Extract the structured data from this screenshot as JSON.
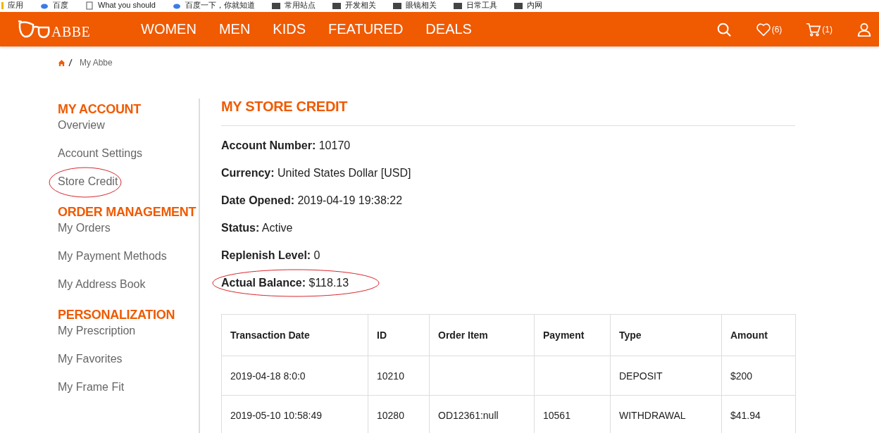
{
  "bookmarks": [
    {
      "label": "应用",
      "kind": "apps"
    },
    {
      "label": "百度",
      "kind": "cloud"
    },
    {
      "label": "What you should",
      "kind": "page"
    },
    {
      "label": "百度一下，你就知道",
      "kind": "cloud"
    },
    {
      "label": "常用站点",
      "kind": "folder"
    },
    {
      "label": "开发相关",
      "kind": "folder"
    },
    {
      "label": "眼镜相关",
      "kind": "folder"
    },
    {
      "label": "日常工具",
      "kind": "folder"
    },
    {
      "label": "内网",
      "kind": "folder"
    }
  ],
  "header": {
    "logo": "ABBE",
    "nav": [
      "WOMEN",
      "MEN",
      "KIDS",
      "FEATURED",
      "DEALS"
    ],
    "favorites_count": "(6)",
    "cart_count": "(1)"
  },
  "breadcrumb": [
    "My Abbe"
  ],
  "sidebar": [
    {
      "heading": "MY ACCOUNT",
      "items": [
        {
          "label": "Overview",
          "circled": false
        },
        {
          "label": "Account Settings",
          "circled": false
        },
        {
          "label": "Store Credit",
          "circled": true
        }
      ]
    },
    {
      "heading": "ORDER MANAGEMENT",
      "items": [
        {
          "label": "My Orders",
          "circled": false
        },
        {
          "label": "My Payment Methods",
          "circled": false
        },
        {
          "label": "My Address Book",
          "circled": false
        }
      ]
    },
    {
      "heading": "PERSONALIZATION",
      "items": [
        {
          "label": "My Prescription",
          "circled": false
        },
        {
          "label": "My Favorites",
          "circled": false
        },
        {
          "label": "My Frame Fit",
          "circled": false
        }
      ]
    }
  ],
  "title": "MY STORE CREDIT",
  "fields": [
    {
      "label": "Account Number:",
      "value": "10170",
      "circled": false
    },
    {
      "label": "Currency:",
      "value": "United States Dollar [USD]",
      "circled": false
    },
    {
      "label": "Date Opened:",
      "value": "2019-04-19 19:38:22",
      "circled": false
    },
    {
      "label": "Status:",
      "value": "Active",
      "circled": false
    },
    {
      "label": "Replenish Level:",
      "value": "0",
      "circled": false
    },
    {
      "label": "Actual Balance:",
      "value": "$118.13",
      "circled": true
    }
  ],
  "table": {
    "columns": [
      "Transaction Date",
      "ID",
      "Order Item",
      "Payment",
      "Type",
      "Amount"
    ],
    "rows": [
      [
        "2019-04-18 8:0:0",
        "10210",
        "",
        "",
        "DEPOSIT",
        "$200"
      ],
      [
        "2019-05-10 10:58:49",
        "10280",
        "OD12361:null",
        "10561",
        "WITHDRAWAL",
        "$41.94"
      ]
    ]
  }
}
